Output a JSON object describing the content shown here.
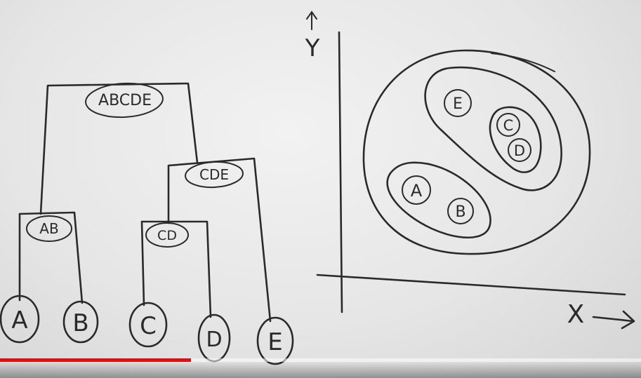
{
  "dendrogram": {
    "leaves": [
      "A",
      "B",
      "C",
      "D",
      "E"
    ],
    "merges": [
      "AB",
      "CD",
      "CDE",
      "ABCDE"
    ]
  },
  "scatter": {
    "y_axis_label": "Y",
    "x_axis_label": "X",
    "points": [
      "E",
      "C",
      "D",
      "A",
      "B"
    ]
  },
  "video": {
    "progress_fraction": 0.298,
    "progress_color": "#ff0000"
  }
}
